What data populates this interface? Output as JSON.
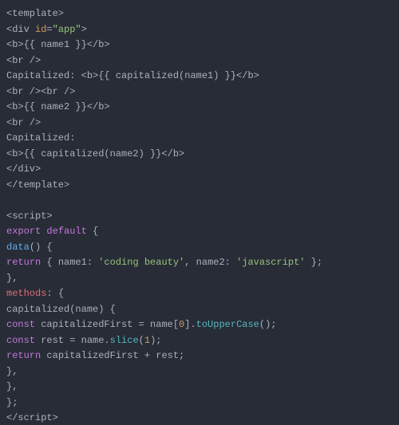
{
  "lines": [
    {
      "id": "l01",
      "segments": [
        {
          "cls": "c-default",
          "text": "<template>"
        }
      ]
    },
    {
      "id": "l02",
      "segments": [
        {
          "cls": "c-default",
          "text": "<div "
        },
        {
          "cls": "c-attr",
          "text": "id"
        },
        {
          "cls": "c-default",
          "text": "="
        },
        {
          "cls": "c-string",
          "text": "\"app\""
        },
        {
          "cls": "c-default",
          "text": ">"
        }
      ]
    },
    {
      "id": "l03",
      "segments": [
        {
          "cls": "c-default",
          "text": "<b>{{ name1 }}</b>"
        }
      ]
    },
    {
      "id": "l04",
      "segments": [
        {
          "cls": "c-default",
          "text": "<br />"
        }
      ]
    },
    {
      "id": "l05",
      "segments": [
        {
          "cls": "c-default",
          "text": "Capitalized: <b>{{ capitalized(name1) }}</b>"
        }
      ]
    },
    {
      "id": "l06",
      "segments": [
        {
          "cls": "c-default",
          "text": "<br /><br />"
        }
      ]
    },
    {
      "id": "l07",
      "segments": [
        {
          "cls": "c-default",
          "text": "<b>{{ name2 }}</b>"
        }
      ]
    },
    {
      "id": "l08",
      "segments": [
        {
          "cls": "c-default",
          "text": "<br />"
        }
      ]
    },
    {
      "id": "l09",
      "segments": [
        {
          "cls": "c-default",
          "text": "Capitalized:"
        }
      ]
    },
    {
      "id": "l10",
      "segments": [
        {
          "cls": "c-default",
          "text": "<b>{{ capitalized(name2) }}</b>"
        }
      ]
    },
    {
      "id": "l11",
      "segments": [
        {
          "cls": "c-default",
          "text": "</div>"
        }
      ]
    },
    {
      "id": "l12",
      "segments": [
        {
          "cls": "c-default",
          "text": "</template>"
        }
      ]
    },
    {
      "id": "l13",
      "segments": []
    },
    {
      "id": "l14",
      "segments": [
        {
          "cls": "c-default",
          "text": "<script>"
        }
      ]
    },
    {
      "id": "l15",
      "segments": [
        {
          "cls": "c-keyword",
          "text": "export"
        },
        {
          "cls": "c-default",
          "text": " "
        },
        {
          "cls": "c-keyword",
          "text": "default"
        },
        {
          "cls": "c-default",
          "text": " {"
        }
      ]
    },
    {
      "id": "l16",
      "segments": [
        {
          "cls": "c-func",
          "text": "data"
        },
        {
          "cls": "c-default",
          "text": "() {"
        }
      ]
    },
    {
      "id": "l17",
      "segments": [
        {
          "cls": "c-keyword",
          "text": "return"
        },
        {
          "cls": "c-default",
          "text": " { name1: "
        },
        {
          "cls": "c-string",
          "text": "'coding beauty'"
        },
        {
          "cls": "c-default",
          "text": ", name2: "
        },
        {
          "cls": "c-string",
          "text": "'javascript'"
        },
        {
          "cls": "c-default",
          "text": " };"
        }
      ]
    },
    {
      "id": "l18",
      "segments": [
        {
          "cls": "c-default",
          "text": "},"
        }
      ]
    },
    {
      "id": "l19",
      "segments": [
        {
          "cls": "c-prop",
          "text": "methods"
        },
        {
          "cls": "c-default",
          "text": ": {"
        }
      ]
    },
    {
      "id": "l20",
      "segments": [
        {
          "cls": "c-default",
          "text": "capitalized(name) {"
        }
      ]
    },
    {
      "id": "l21",
      "segments": [
        {
          "cls": "c-keyword",
          "text": "const"
        },
        {
          "cls": "c-default",
          "text": " capitalizedFirst = name["
        },
        {
          "cls": "c-num",
          "text": "0"
        },
        {
          "cls": "c-default",
          "text": "]."
        },
        {
          "cls": "c-method",
          "text": "toUpperCase"
        },
        {
          "cls": "c-default",
          "text": "();"
        }
      ]
    },
    {
      "id": "l22",
      "segments": [
        {
          "cls": "c-keyword",
          "text": "const"
        },
        {
          "cls": "c-default",
          "text": " rest = name."
        },
        {
          "cls": "c-method",
          "text": "slice"
        },
        {
          "cls": "c-default",
          "text": "("
        },
        {
          "cls": "c-num",
          "text": "1"
        },
        {
          "cls": "c-default",
          "text": ");"
        }
      ]
    },
    {
      "id": "l23",
      "segments": [
        {
          "cls": "c-keyword",
          "text": "return"
        },
        {
          "cls": "c-default",
          "text": " capitalizedFirst + rest;"
        }
      ]
    },
    {
      "id": "l24",
      "segments": [
        {
          "cls": "c-default",
          "text": "},"
        }
      ]
    },
    {
      "id": "l25",
      "segments": [
        {
          "cls": "c-default",
          "text": "},"
        }
      ]
    },
    {
      "id": "l26",
      "segments": [
        {
          "cls": "c-default",
          "text": "};"
        }
      ]
    },
    {
      "id": "l27",
      "segments": [
        {
          "cls": "c-default",
          "text": "</scr"
        },
        {
          "cls": "c-default",
          "text": "ipt>"
        }
      ]
    }
  ]
}
